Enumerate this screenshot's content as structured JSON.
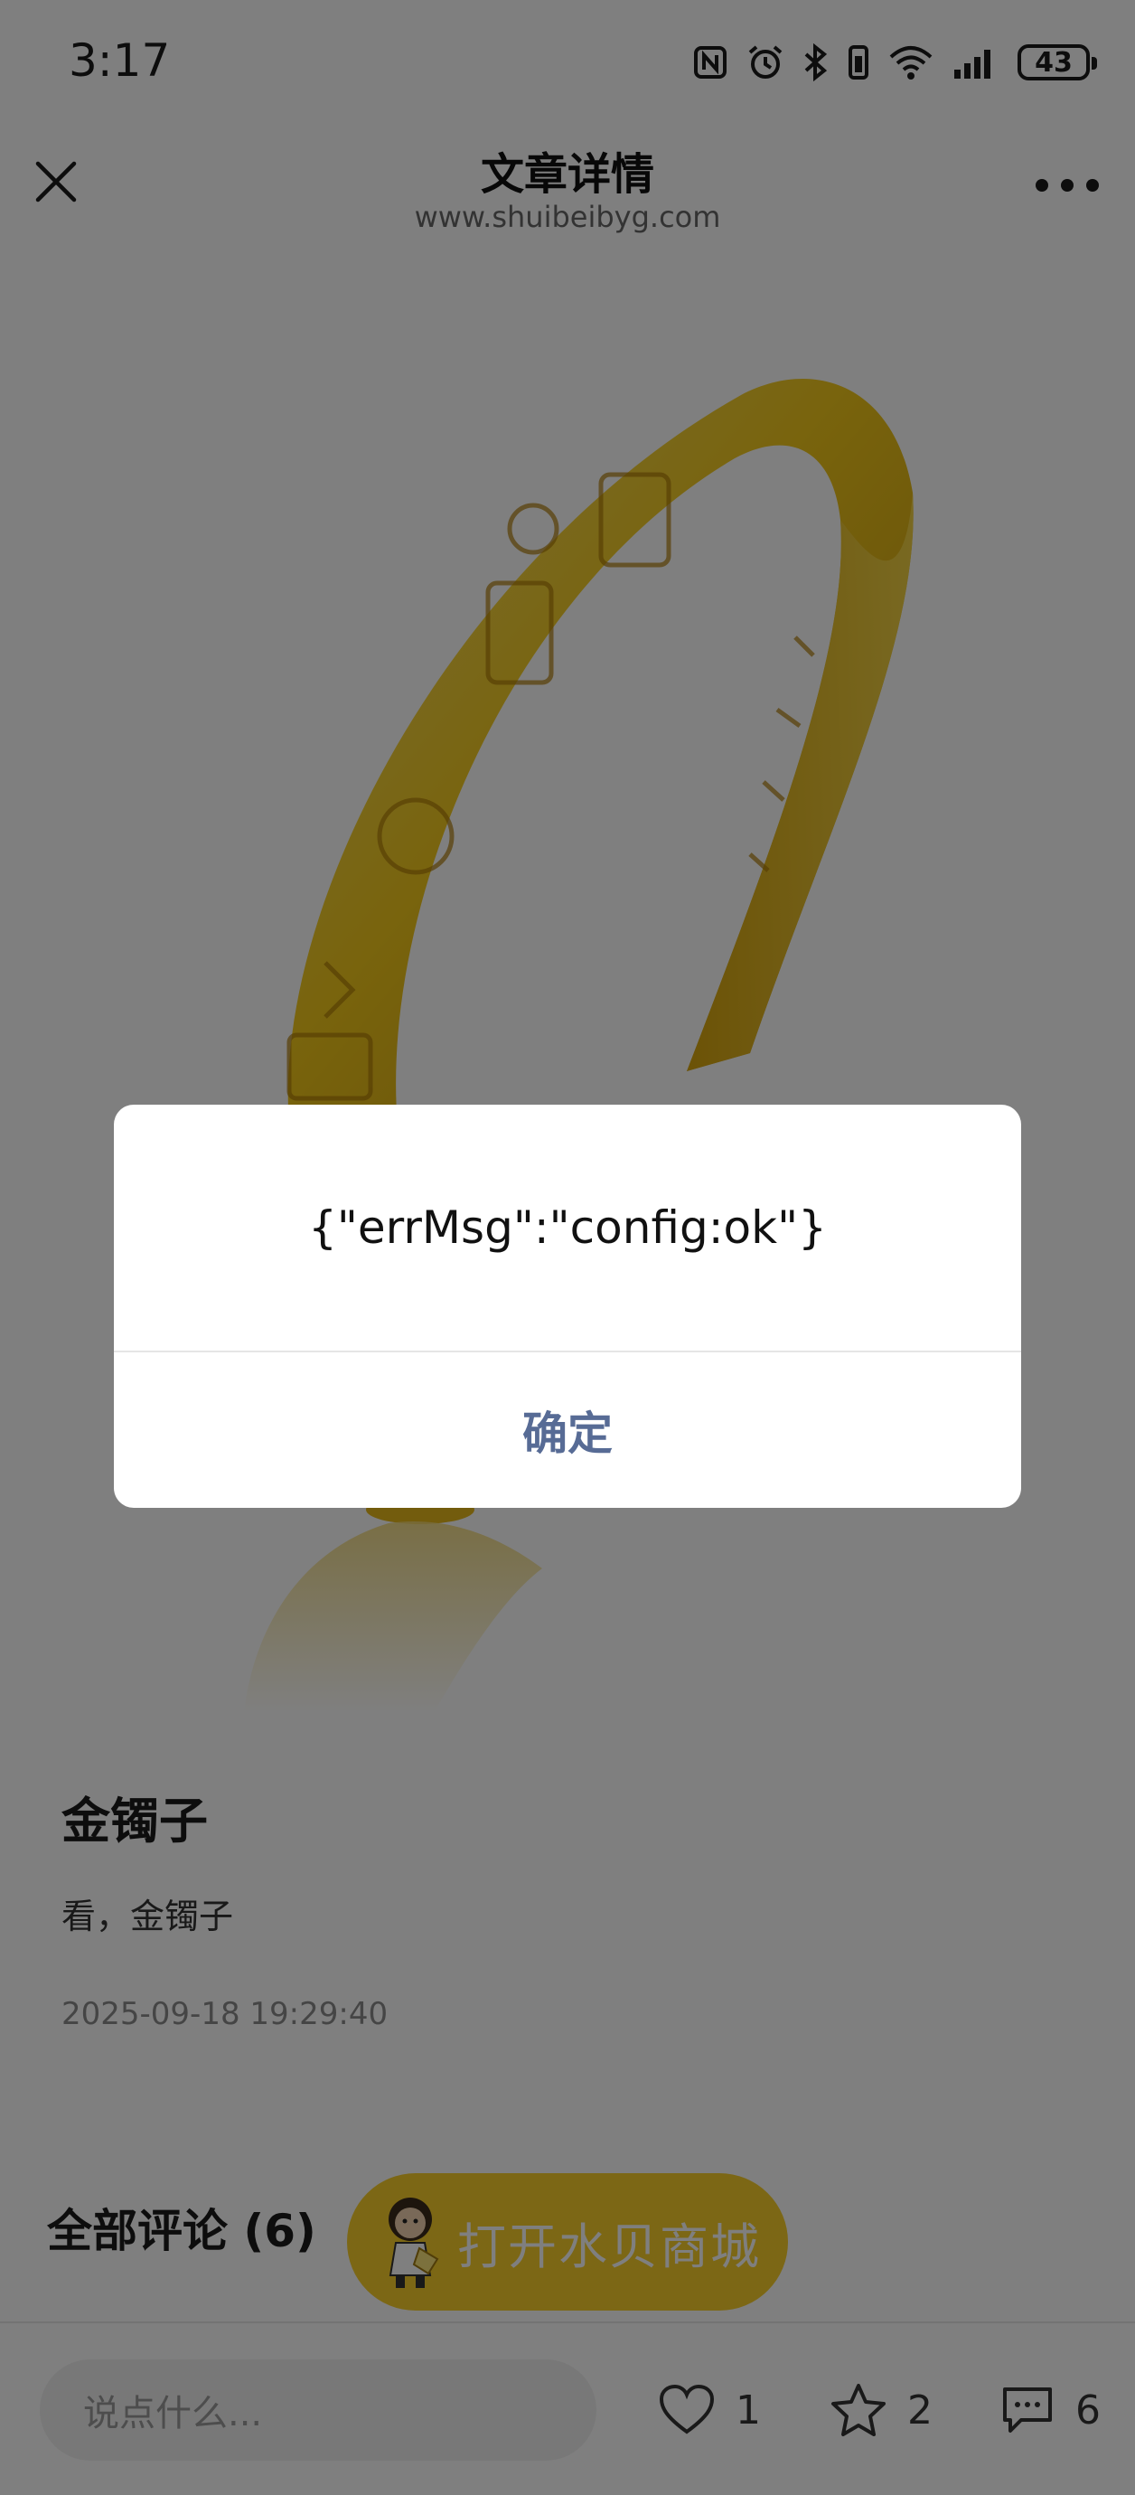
{
  "status_bar": {
    "time": "3:17",
    "battery": "43"
  },
  "nav": {
    "title": "文章详情",
    "subtitle": "www.shuibeibyg.com"
  },
  "article": {
    "title": "金镯子",
    "body": "看，金镯子",
    "date": "2025-09-18 19:29:40"
  },
  "comments": {
    "heading": "全部评论 (6)"
  },
  "shop_button": {
    "label": "打开水贝商城"
  },
  "bottom_bar": {
    "comment_placeholder": "说点什么...",
    "like_count": "1",
    "favorite_count": "2",
    "comment_count": "6"
  },
  "dialog": {
    "message": "{\"errMsg\":\"config:ok\"}",
    "confirm_label": "确定"
  },
  "colors": {
    "accent_gold": "#f8cf2a",
    "dialog_link": "#576b95"
  }
}
